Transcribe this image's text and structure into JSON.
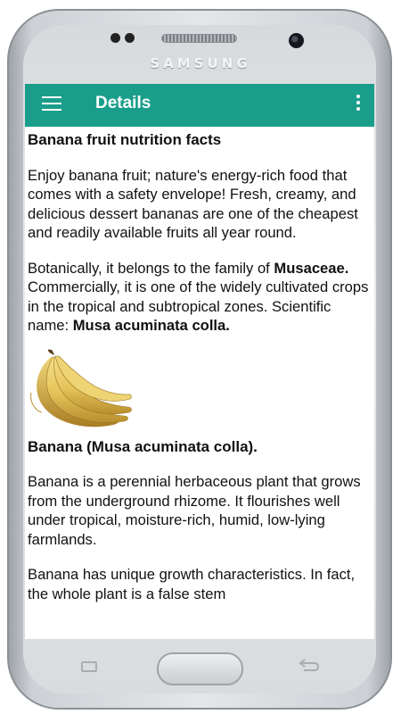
{
  "device": {
    "brand": "SAMSUNG"
  },
  "appbar": {
    "menu_icon": "hamburger-menu-icon",
    "title": "Details",
    "more_icon": "more-vertical-icon",
    "color": "#1a9e8b"
  },
  "article": {
    "heading": "Banana fruit nutrition facts",
    "paragraph1": "Enjoy banana fruit; nature's energy-rich food that comes with a safety envelope! Fresh, creamy, and delicious dessert bananas are one of the cheapest and readily available fruits all year round.",
    "paragraph2_part1": "Botanically, it belongs to the family of ",
    "paragraph2_bold1": "Musaceae.",
    "paragraph2_part2": " Commercially, it is one of the widely cultivated crops in the tropical and subtropical zones. Scientific name: ",
    "paragraph2_bold2": "Musa acuminata colla.",
    "image": "banana-bunch-image",
    "caption": "Banana (Musa acuminata colla).",
    "paragraph3": "Banana is a perennial herbaceous plant that grows from the underground rhizome. It flourishes well under tropical, moisture-rich, humid, low-lying farmlands.",
    "paragraph4": "Banana has unique growth characteristics. In fact, the whole plant is a false stem"
  }
}
